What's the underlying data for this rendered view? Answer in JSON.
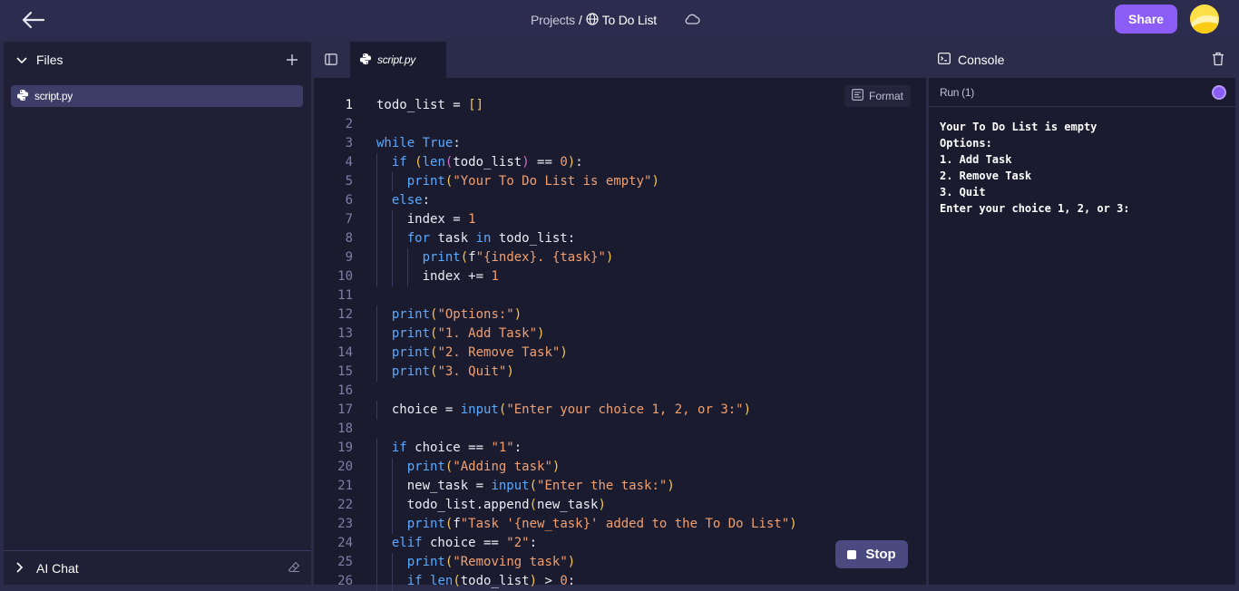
{
  "header": {
    "breadcrumb_root": "Projects",
    "breadcrumb_sep": "/",
    "project_name": "To Do List",
    "share_label": "Share"
  },
  "files_panel": {
    "title": "Files",
    "items": [
      {
        "label": "script.py"
      }
    ],
    "ai_chat_label": "AI Chat"
  },
  "editor": {
    "tab_label": "script.py",
    "format_label": "Format",
    "stop_label": "Stop"
  },
  "code_lines": [
    "todo_list = []",
    "",
    "while True:",
    "  if (len(todo_list) == 0):",
    "    print(\"Your To Do List is empty\")",
    "  else:",
    "    index = 1",
    "    for task in todo_list:",
    "      print(f\"{index}. {task}\")",
    "      index += 1",
    "",
    "  print(\"Options:\")",
    "  print(\"1. Add Task\")",
    "  print(\"2. Remove Task\")",
    "  print(\"3. Quit\")",
    "",
    "  choice = input(\"Enter your choice 1, 2, or 3:\")",
    "",
    "  if choice == \"1\":",
    "    print(\"Adding task\")",
    "    new_task = input(\"Enter the task:\")",
    "    todo_list.append(new_task)",
    "    print(f\"Task '{new_task}' added to the To Do List\")",
    "  elif choice == \"2\":",
    "    print(\"Removing task\")",
    "    if len(todo_list) > 0:"
  ],
  "console": {
    "title": "Console",
    "run_label": "Run (1)",
    "output": [
      "Your To Do List is empty",
      "Options:",
      "1. Add Task",
      "2. Remove Task",
      "3. Quit",
      "Enter your choice 1, 2, or 3:"
    ]
  },
  "colors": {
    "accent": "#8b5cf6",
    "keyword": "#5aa9ff",
    "string": "#f0a070",
    "bracket": "#f5c84c"
  }
}
